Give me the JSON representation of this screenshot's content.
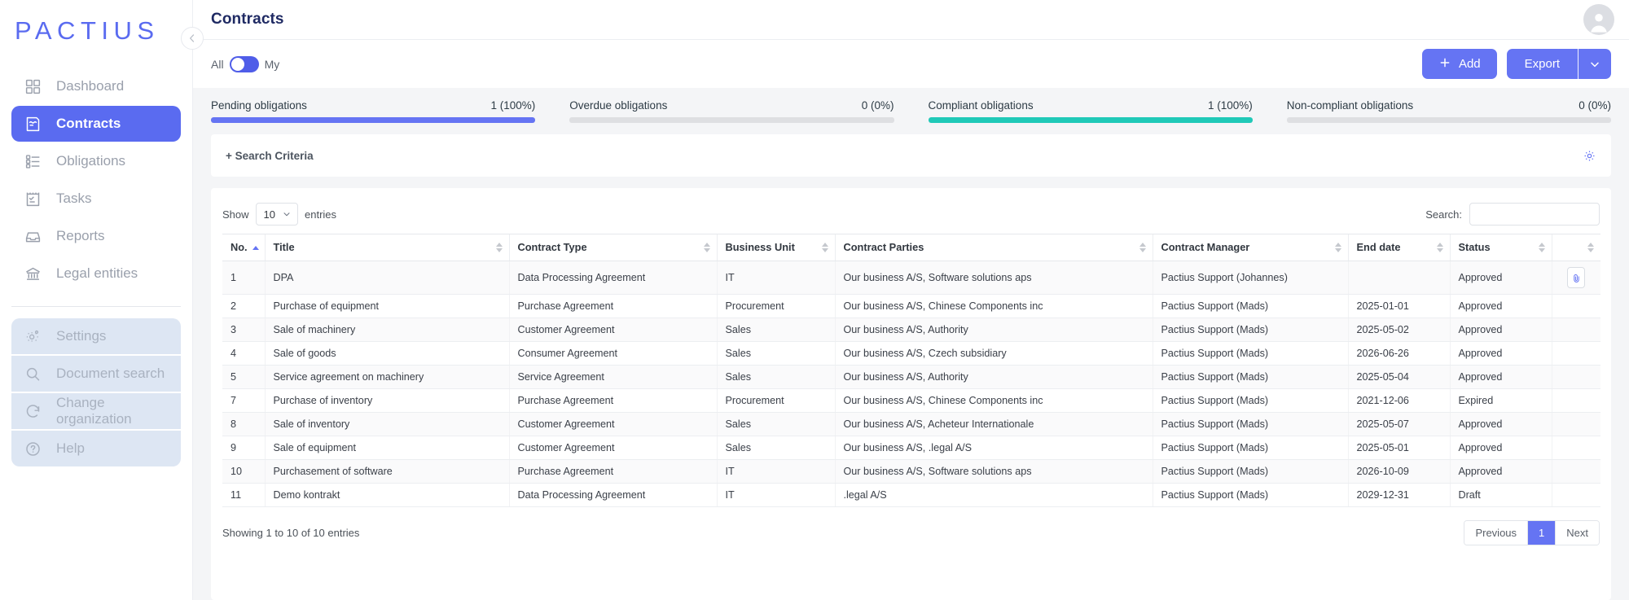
{
  "brand": {
    "logo": "PACTIUS"
  },
  "sidebar": {
    "primary": [
      {
        "label": "Dashboard",
        "icon": "dashboard-icon",
        "active": false
      },
      {
        "label": "Contracts",
        "icon": "contracts-icon",
        "active": true
      },
      {
        "label": "Obligations",
        "icon": "obligations-icon",
        "active": false
      },
      {
        "label": "Tasks",
        "icon": "tasks-icon",
        "active": false
      },
      {
        "label": "Reports",
        "icon": "reports-icon",
        "active": false
      },
      {
        "label": "Legal entities",
        "icon": "bank-icon",
        "active": false
      }
    ],
    "secondary": [
      {
        "label": "Settings",
        "icon": "gear-icon"
      },
      {
        "label": "Document search",
        "icon": "search-icon"
      },
      {
        "label": "Change organization",
        "icon": "refresh-icon"
      },
      {
        "label": "Help",
        "icon": "help-icon"
      }
    ]
  },
  "header": {
    "title": "Contracts",
    "toggle_left": "All",
    "toggle_right": "My",
    "add_label": "Add",
    "export_label": "Export"
  },
  "stats": [
    {
      "label": "Pending obligations",
      "value": "1 (100%)",
      "percent": 100,
      "color": "#6574f3"
    },
    {
      "label": "Overdue obligations",
      "value": "0 (0%)",
      "percent": 0,
      "color": "#6574f3"
    },
    {
      "label": "Compliant obligations",
      "value": "1 (100%)",
      "percent": 100,
      "color": "#20c9b8"
    },
    {
      "label": "Non-compliant obligations",
      "value": "0 (0%)",
      "percent": 0,
      "color": "#20c9b8"
    }
  ],
  "search_criteria": {
    "label": "+ Search Criteria"
  },
  "table_controls": {
    "show_label": "Show",
    "entries_label": "entries",
    "page_size": "10",
    "search_label": "Search:",
    "search_value": "",
    "search_placeholder": ""
  },
  "table": {
    "columns": [
      {
        "label": "No.",
        "sort": "asc"
      },
      {
        "label": "Title",
        "sort": "none"
      },
      {
        "label": "Contract Type",
        "sort": "none"
      },
      {
        "label": "Business Unit",
        "sort": "none"
      },
      {
        "label": "Contract Parties",
        "sort": "none"
      },
      {
        "label": "Contract Manager",
        "sort": "none"
      },
      {
        "label": "End date",
        "sort": "none"
      },
      {
        "label": "Status",
        "sort": "none"
      },
      {
        "label": "",
        "sort": "none"
      }
    ],
    "rows": [
      {
        "no": "1",
        "title": "DPA",
        "type": "Data Processing Agreement",
        "unit": "IT",
        "parties": "Our business A/S, Software solutions aps",
        "manager": "Pactius Support (Johannes)",
        "end": "",
        "status": "Approved",
        "attachment": true
      },
      {
        "no": "2",
        "title": "Purchase of equipment",
        "type": "Purchase Agreement",
        "unit": "Procurement",
        "parties": "Our business A/S, Chinese Components inc",
        "manager": "Pactius Support (Mads)",
        "end": "2025-01-01",
        "status": "Approved",
        "attachment": false
      },
      {
        "no": "3",
        "title": "Sale of machinery",
        "type": "Customer Agreement",
        "unit": "Sales",
        "parties": "Our business A/S, Authority",
        "manager": "Pactius Support (Mads)",
        "end": "2025-05-02",
        "status": "Approved",
        "attachment": false
      },
      {
        "no": "4",
        "title": "Sale of goods",
        "type": "Consumer Agreement",
        "unit": "Sales",
        "parties": "Our business A/S, Czech subsidiary",
        "manager": "Pactius Support (Mads)",
        "end": "2026-06-26",
        "status": "Approved",
        "attachment": false
      },
      {
        "no": "5",
        "title": "Service agreement on machinery",
        "type": "Service Agreement",
        "unit": "Sales",
        "parties": "Our business A/S, Authority",
        "manager": "Pactius Support (Mads)",
        "end": "2025-05-04",
        "status": "Approved",
        "attachment": false
      },
      {
        "no": "7",
        "title": "Purchase of inventory",
        "type": "Purchase Agreement",
        "unit": "Procurement",
        "parties": "Our business A/S, Chinese Components inc",
        "manager": "Pactius Support (Mads)",
        "end": "2021-12-06",
        "status": "Expired",
        "attachment": false
      },
      {
        "no": "8",
        "title": "Sale of inventory",
        "type": "Customer Agreement",
        "unit": "Sales",
        "parties": "Our business A/S, Acheteur Internationale",
        "manager": "Pactius Support (Mads)",
        "end": "2025-05-07",
        "status": "Approved",
        "attachment": false
      },
      {
        "no": "9",
        "title": "Sale of equipment",
        "type": "Customer Agreement",
        "unit": "Sales",
        "parties": "Our business A/S, .legal A/S",
        "manager": "Pactius Support (Mads)",
        "end": "2025-05-01",
        "status": "Approved",
        "attachment": false
      },
      {
        "no": "10",
        "title": "Purchasement of software",
        "type": "Purchase Agreement",
        "unit": "IT",
        "parties": "Our business A/S, Software solutions aps",
        "manager": "Pactius Support (Mads)",
        "end": "2026-10-09",
        "status": "Approved",
        "attachment": false
      },
      {
        "no": "11",
        "title": "Demo kontrakt",
        "type": "Data Processing Agreement",
        "unit": "IT",
        "parties": ".legal A/S",
        "manager": "Pactius Support (Mads)",
        "end": "2029-12-31",
        "status": "Draft",
        "attachment": false
      }
    ]
  },
  "footer": {
    "showing": "Showing 1 to 10 of 10 entries",
    "previous": "Previous",
    "current_page": "1",
    "next": "Next"
  },
  "colors": {
    "accent": "#6574f3",
    "teal": "#20c9b8",
    "title": "#1f2a63",
    "sidebar_muted": "#9aa0ac"
  }
}
